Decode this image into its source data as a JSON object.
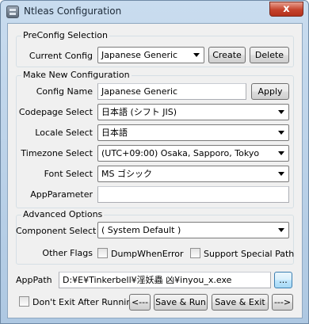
{
  "window": {
    "title": "Ntleas Configuration",
    "close_glyph": "x"
  },
  "preconfig": {
    "group_title": "PreConfig Selection",
    "current_config_label": "Current Config",
    "current_config_value": "Japanese Generic",
    "create_label": "Create",
    "delete_label": "Delete"
  },
  "new_config": {
    "group_title": "Make New Configuration",
    "config_name_label": "Config Name",
    "config_name_value": "Japanese Generic",
    "apply_label": "Apply",
    "codepage_label": "Codepage Select",
    "codepage_value": "日本語 (シフト JIS)",
    "locale_label": "Locale Select",
    "locale_value": "日本語",
    "timezone_label": "Timezone Select",
    "timezone_value": "(UTC+09:00) Osaka, Sapporo, Tokyo",
    "font_label": "Font Select",
    "font_value": "MS ゴシック",
    "app_parameter_label": "AppParameter",
    "app_parameter_value": ""
  },
  "advanced": {
    "group_title": "Advanced Options",
    "component_label": "Component Select",
    "component_value": "( System Default )",
    "other_flags_label": "Other Flags",
    "dump_when_error_label": "DumpWhenError",
    "support_special_path_label": "Support Special Path"
  },
  "footer": {
    "app_path_label": "AppPath",
    "app_path_value": "D:¥E¥Tinkerbell¥淫妖蟲 凶¥inyou_x.exe",
    "browse_label": "...",
    "dont_exit_label": "Don't Exit After Running",
    "prev_label": "<---",
    "save_run_label": "Save & Run",
    "save_exit_label": "Save & Exit",
    "next_label": "--->"
  }
}
